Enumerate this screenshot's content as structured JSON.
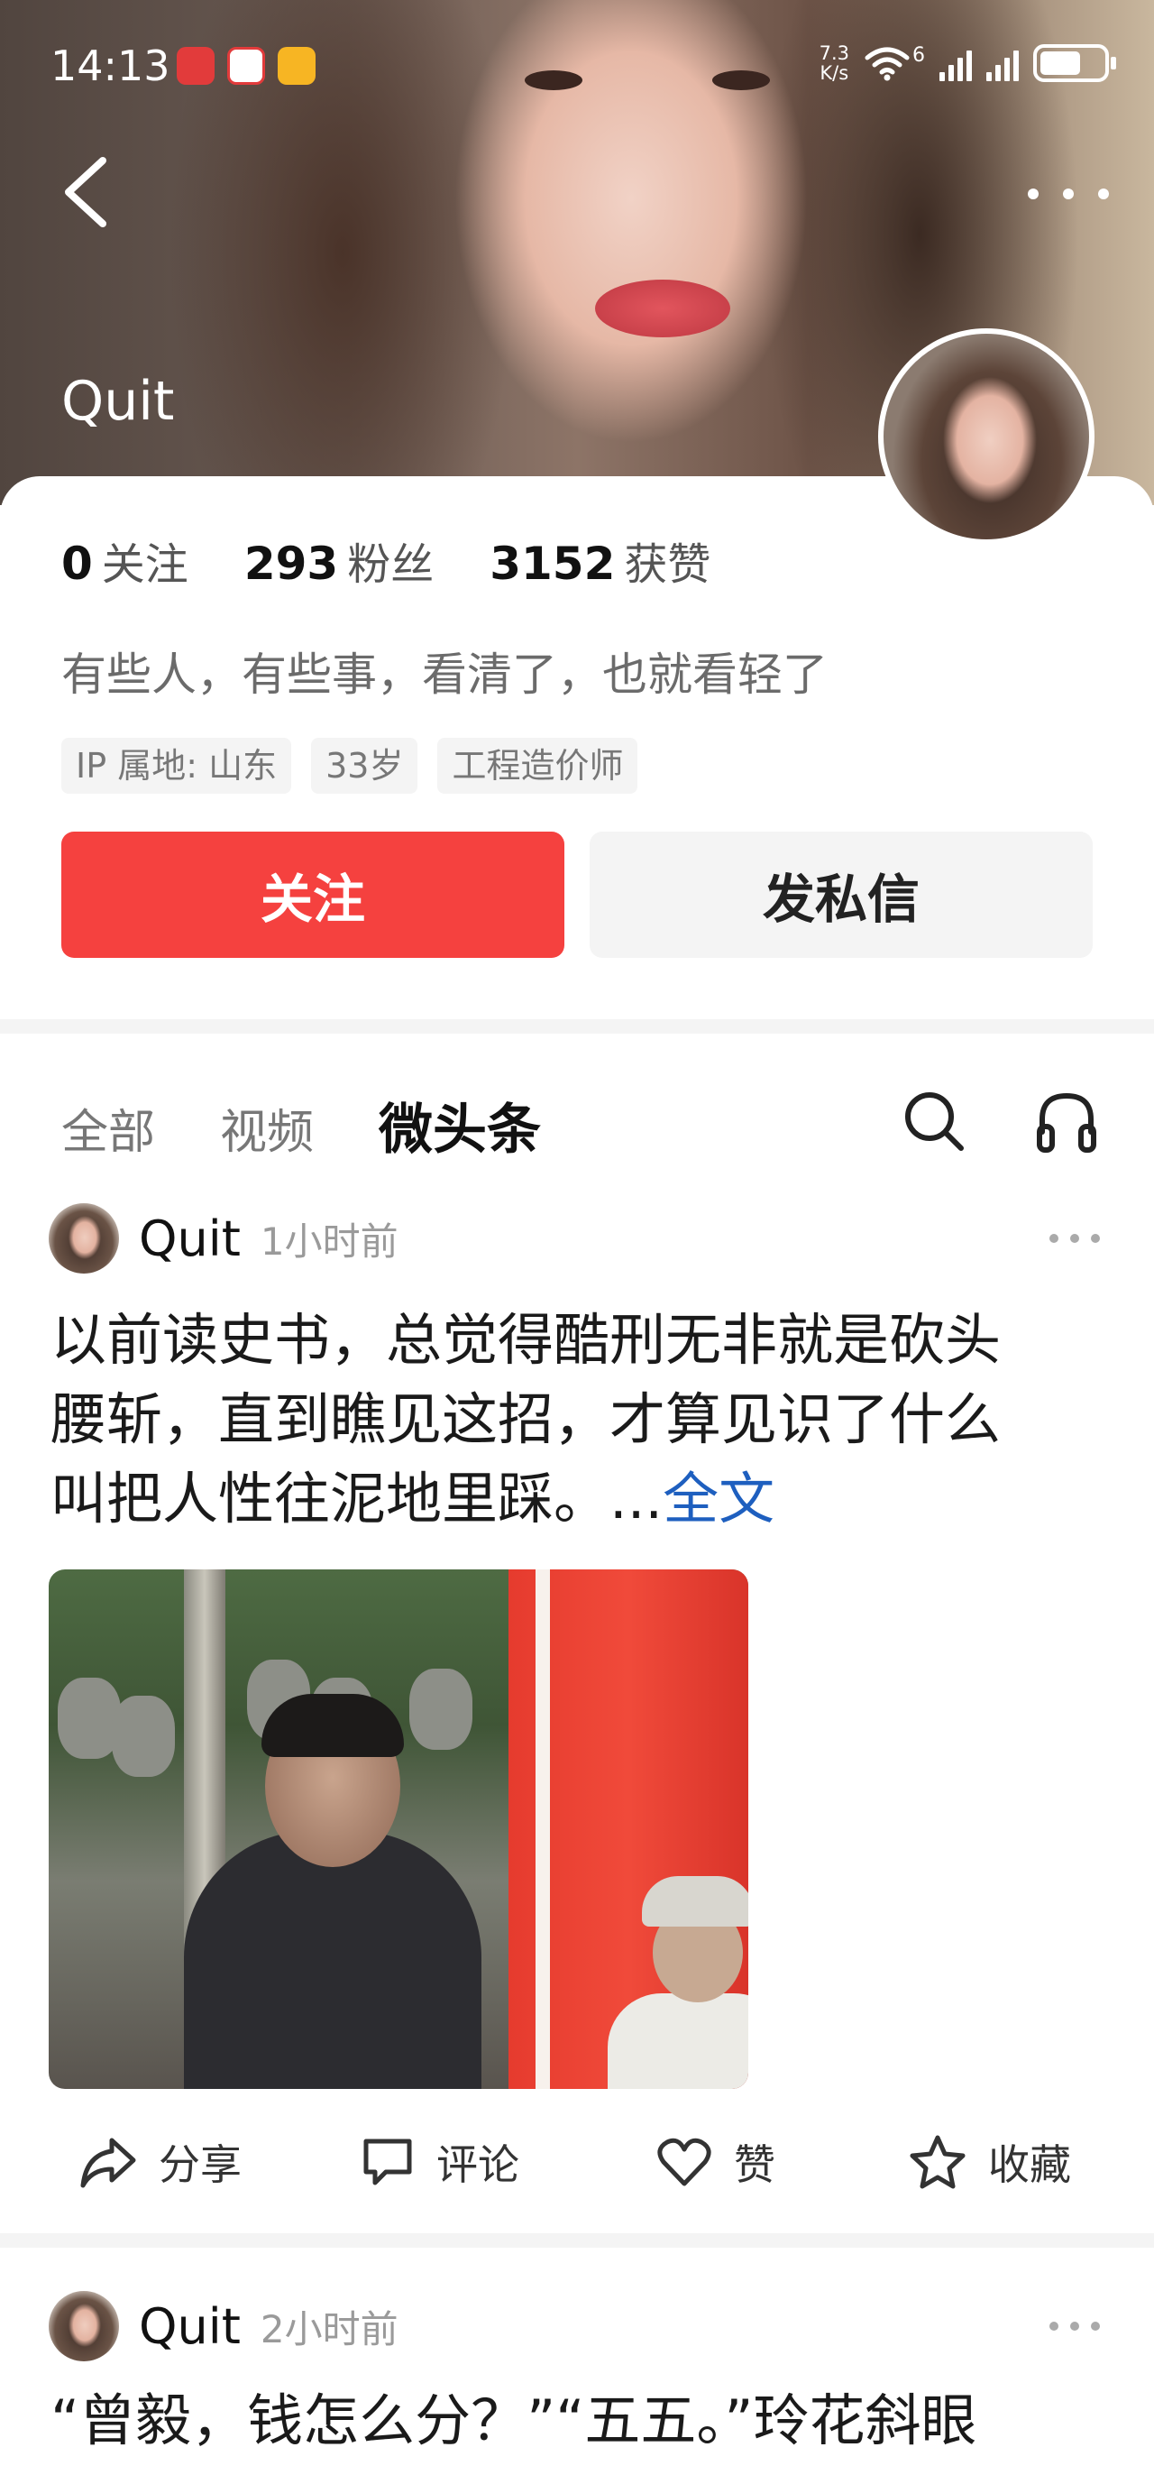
{
  "status_bar": {
    "time": "14:13",
    "net_speed_value": "7.3",
    "net_speed_unit": "K/s",
    "network_type": "6",
    "battery_level": 0.64,
    "app_icons": [
      "app-icon-red",
      "pay-app-icon",
      "yellow-app-icon"
    ]
  },
  "header": {
    "back_icon": "chevron-left-icon",
    "more_icon": "more-horizontal-icon",
    "profile_name": "Quit"
  },
  "stats": [
    {
      "num": "0",
      "label": "关注"
    },
    {
      "num": "293",
      "label": "粉丝"
    },
    {
      "num": "3152",
      "label": "获赞"
    }
  ],
  "bio": "有些人，有些事，看清了，也就看轻了",
  "tags": [
    "IP 属地: 山东",
    "33岁",
    "工程造价师"
  ],
  "buttons": {
    "follow": "关注",
    "message": "发私信"
  },
  "tabs": [
    {
      "label": "全部",
      "active": false
    },
    {
      "label": "视频",
      "active": false
    },
    {
      "label": "微头条",
      "active": true
    }
  ],
  "posts": [
    {
      "author": "Quit",
      "time": "1小时前",
      "text_lines": [
        "以前读史书，总觉得酷刑无非就是砍头",
        "腰斩，直到瞧见这招，才算见识了什么",
        "叫把人性往泥地里踩。..."
      ],
      "more_link": "全文"
    },
    {
      "author": "Quit",
      "time": "2小时前",
      "text_lines": [
        "“曾毅，钱怎么分？”“五五。”玲花斜眼"
      ]
    }
  ],
  "actions": [
    {
      "label": "分享",
      "icon": "share-icon"
    },
    {
      "label": "评论",
      "icon": "comment-icon"
    },
    {
      "label": "赞",
      "icon": "heart-icon"
    },
    {
      "label": "收藏",
      "icon": "star-icon"
    }
  ],
  "colors": {
    "accent": "#f5413f",
    "link": "#1e5fbf",
    "muted": "#9a9a9a"
  }
}
